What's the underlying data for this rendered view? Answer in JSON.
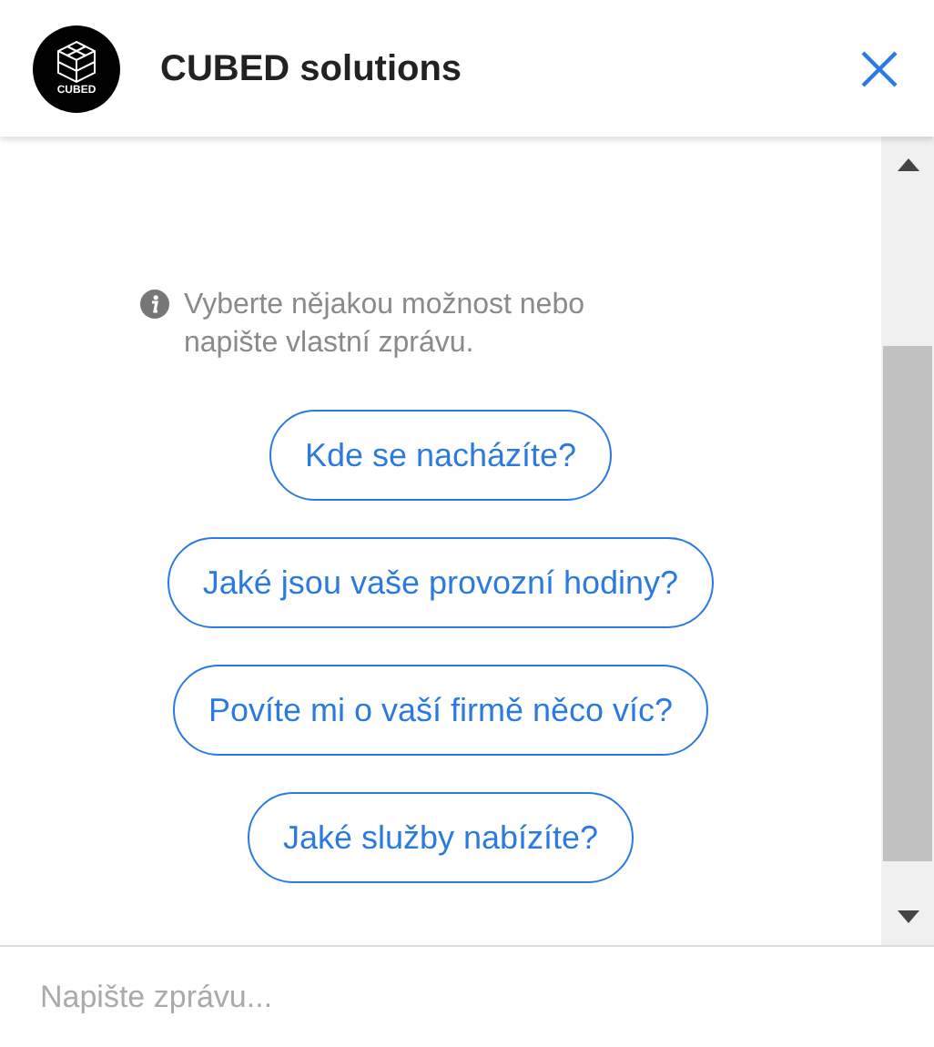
{
  "header": {
    "title": "CUBED solutions",
    "logo_text": "CUBED"
  },
  "notice": "Vyberte nějakou možnost nebo napište vlastní zprávu.",
  "options": [
    "Kde se nacházíte?",
    "Jaké jsou vaše provozní hodiny?",
    "Povíte mi o vaší firmě něco víc?",
    "Jaké služby nabízíte?"
  ],
  "composer": {
    "placeholder": "Napište zprávu..."
  }
}
